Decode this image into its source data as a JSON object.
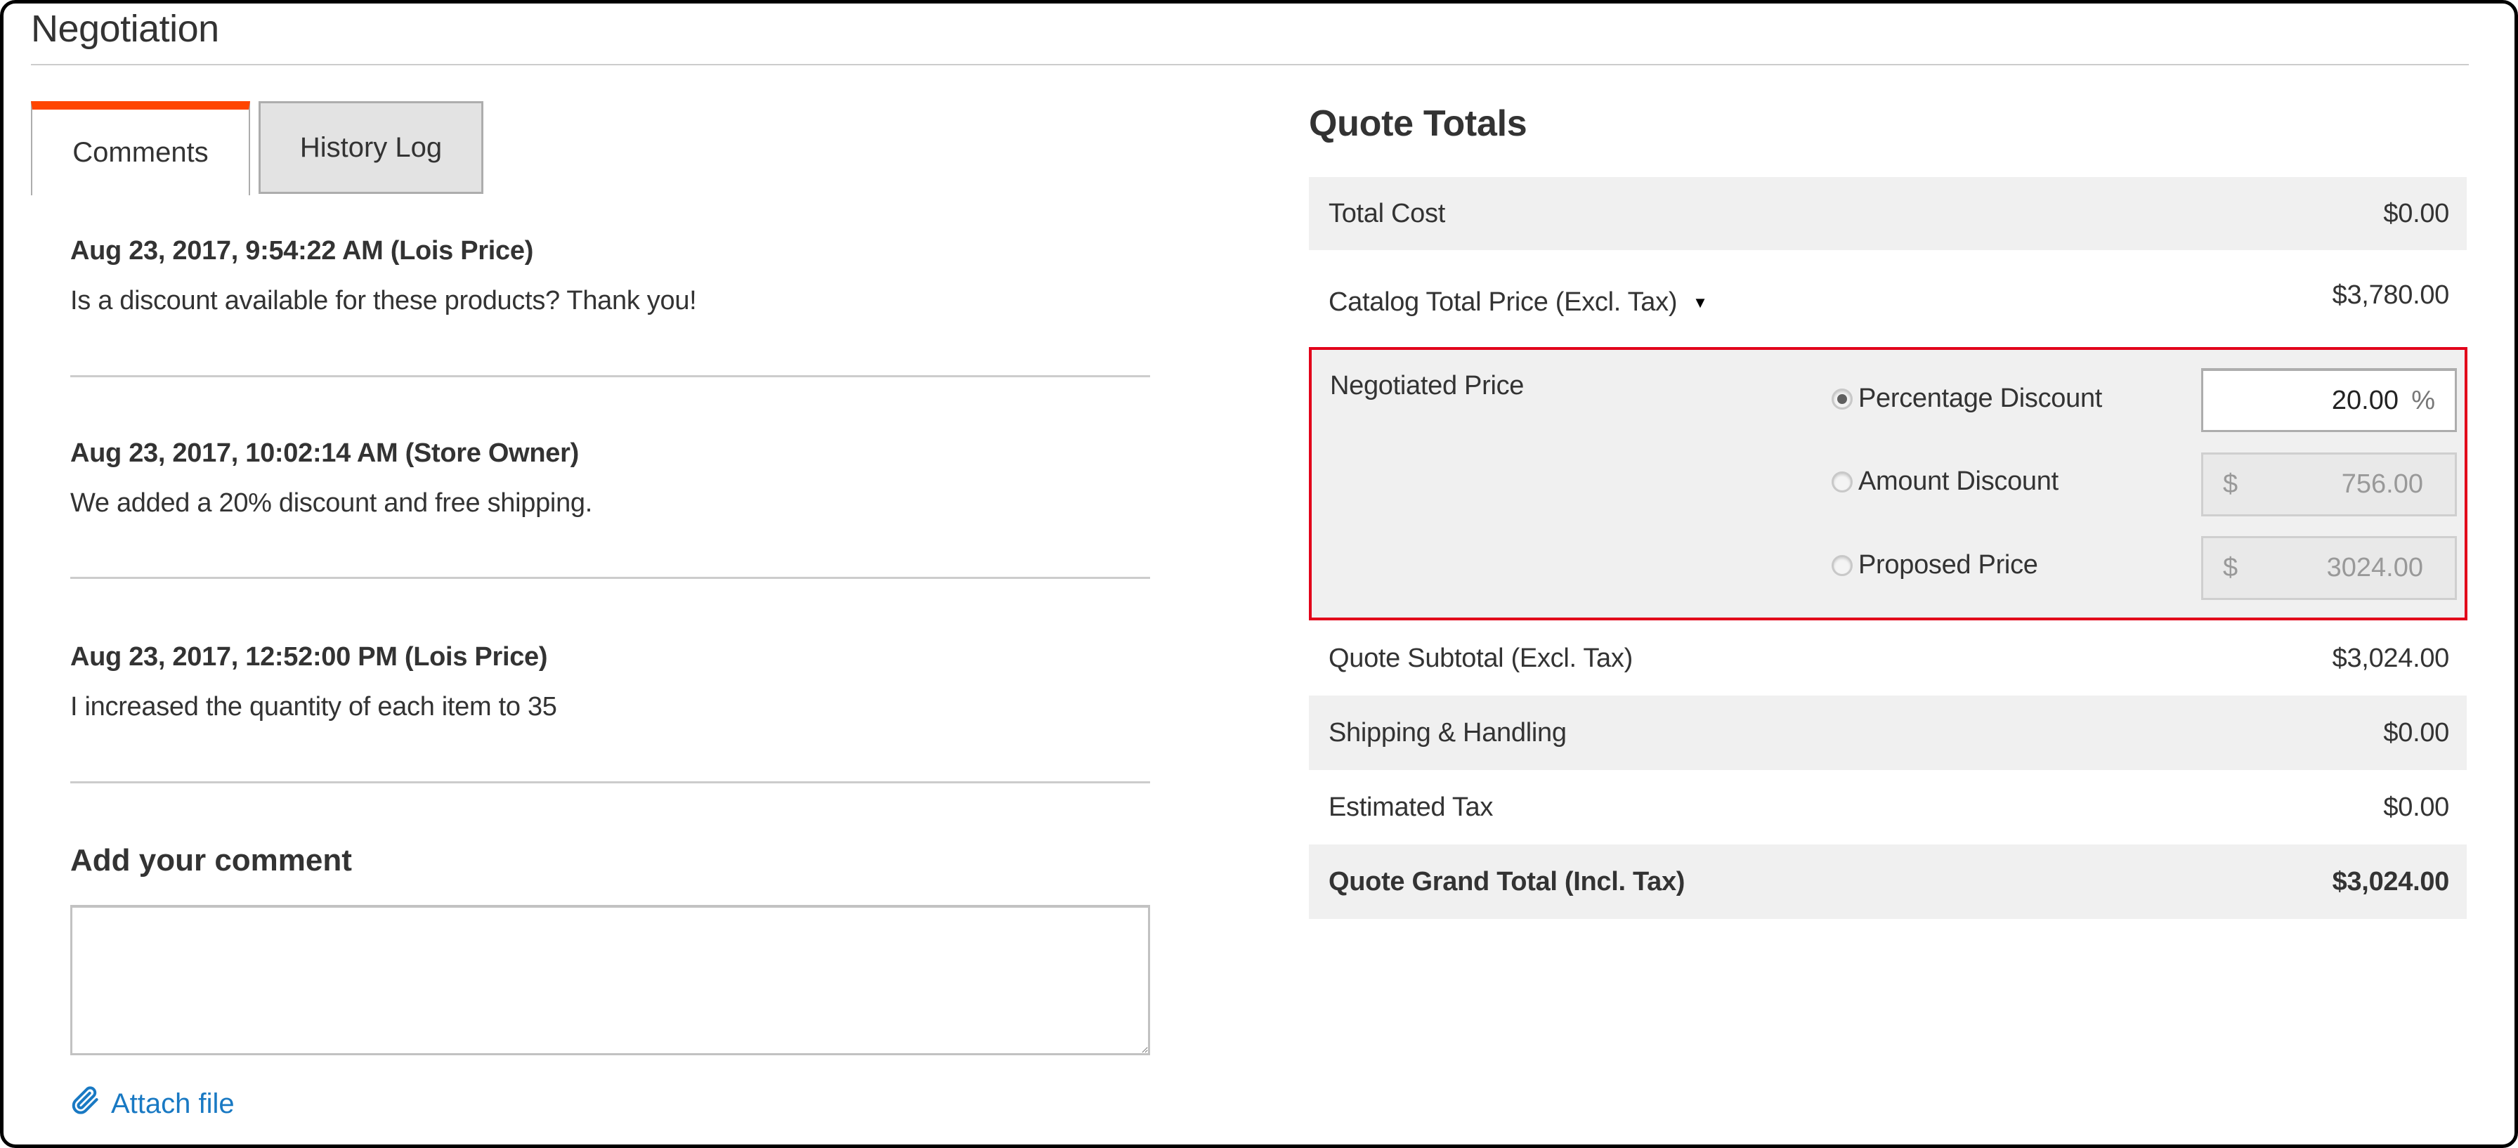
{
  "section": {
    "title": "Negotiation"
  },
  "tabs": [
    {
      "label": "Comments",
      "active": true
    },
    {
      "label": "History Log",
      "active": false
    }
  ],
  "comments": [
    {
      "header": "Aug 23, 2017, 9:54:22 AM (Lois Price)",
      "body": "Is a discount available for these products? Thank you!"
    },
    {
      "header": "Aug 23, 2017, 10:02:14 AM (Store Owner)",
      "body": "We added a 20% discount and free shipping."
    },
    {
      "header": "Aug 23, 2017, 12:52:00 PM (Lois Price)",
      "body": "I increased the quantity of each item to 35"
    }
  ],
  "add_comment": {
    "title": "Add your comment",
    "textarea_value": "",
    "attach_label": "Attach file",
    "attach_icon": "paperclip-icon"
  },
  "totals": {
    "title": "Quote Totals",
    "total_cost": {
      "label": "Total Cost",
      "value": "$0.00"
    },
    "catalog_total": {
      "label": "Catalog Total Price (Excl. Tax)",
      "value": "$3,780.00",
      "icon": "caret-down-icon"
    },
    "negotiated": {
      "label": "Negotiated Price",
      "options": [
        {
          "label": "Percentage Discount",
          "checked": true,
          "prefix": "",
          "value": "20.00",
          "suffix": "%"
        },
        {
          "label": "Amount Discount",
          "checked": false,
          "prefix": "$",
          "value": "756.00",
          "suffix": ""
        },
        {
          "label": "Proposed Price",
          "checked": false,
          "prefix": "$",
          "value": "3024.00",
          "suffix": ""
        }
      ]
    },
    "subtotal": {
      "label": "Quote Subtotal (Excl. Tax)",
      "value": "$3,024.00"
    },
    "shipping": {
      "label": "Shipping & Handling",
      "value": "$0.00"
    },
    "tax": {
      "label": "Estimated Tax",
      "value": "$0.00"
    },
    "grand_total": {
      "label": "Quote Grand Total (Incl. Tax)",
      "value": "$3,024.00"
    }
  },
  "colors": {
    "active_tab_accent": "#ff4500",
    "highlight_border": "#e2001a",
    "link": "#1979c3",
    "row_grey": "#f0f0f0"
  }
}
